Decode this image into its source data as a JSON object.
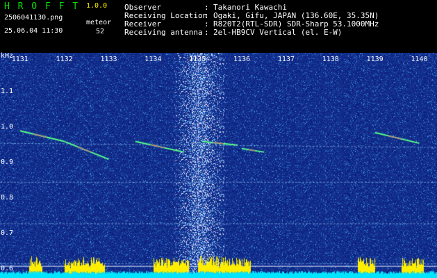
{
  "app": {
    "title": "H R O F F T",
    "version": "1.0.0",
    "filename": "2506041130.png",
    "timestamp": "25.06.04 11:30",
    "type_label": "meteor",
    "count": "52"
  },
  "info": {
    "observer_label": "Observer",
    "observer_value": "Takanori Kawachi",
    "location_label": "Receiving Location",
    "location_value": "Ogaki, Gifu, JAPAN (136.60E, 35.35N)",
    "receiver_label": "Receiver",
    "receiver_value": "R820T2(RTL-SDR) SDR-Sharp 53.1000MHz",
    "antenna_label": "Receiving antenna",
    "antenna_value": "2el-HB9CV Vertical (el. E-W)",
    "separator": ":"
  },
  "spectrogram": {
    "unit_label": "kHz",
    "x_ticks": [
      "1131",
      "1132",
      "1133",
      "1134",
      "1135",
      "1136",
      "1137",
      "1138",
      "1139",
      "1140"
    ],
    "y_ticks": [
      "1.1",
      "1.0",
      "0.9",
      "0.8",
      "0.7",
      "0.6"
    ],
    "x_range": [
      1130.55,
      1140.4
    ],
    "y_range": [
      0.575,
      1.21
    ],
    "bright_column_minute": 1135.05,
    "carrier_khz": [
      0.955,
      0.845,
      0.728,
      0.615
    ],
    "meteor_traces": [
      {
        "start": [
          1131.0,
          0.99
        ],
        "end": [
          1132.0,
          0.96
        ]
      },
      {
        "start": [
          1132.0,
          0.96
        ],
        "end": [
          1133.0,
          0.91
        ]
      },
      {
        "start": [
          1133.6,
          0.96
        ],
        "end": [
          1134.7,
          0.93
        ]
      },
      {
        "start": [
          1135.1,
          0.96
        ],
        "end": [
          1135.9,
          0.95
        ]
      },
      {
        "start": [
          1136.0,
          0.94
        ],
        "end": [
          1136.5,
          0.93
        ]
      },
      {
        "start": [
          1139.0,
          0.985
        ],
        "end": [
          1140.0,
          0.955
        ]
      }
    ],
    "colors": {
      "background": "#0a1a78",
      "noise": "#3a5cff",
      "trace": "#55ff88",
      "trace_hot": "#ff5577",
      "level_bar": "#00e5ff",
      "level_peak": "#ffee00"
    }
  }
}
